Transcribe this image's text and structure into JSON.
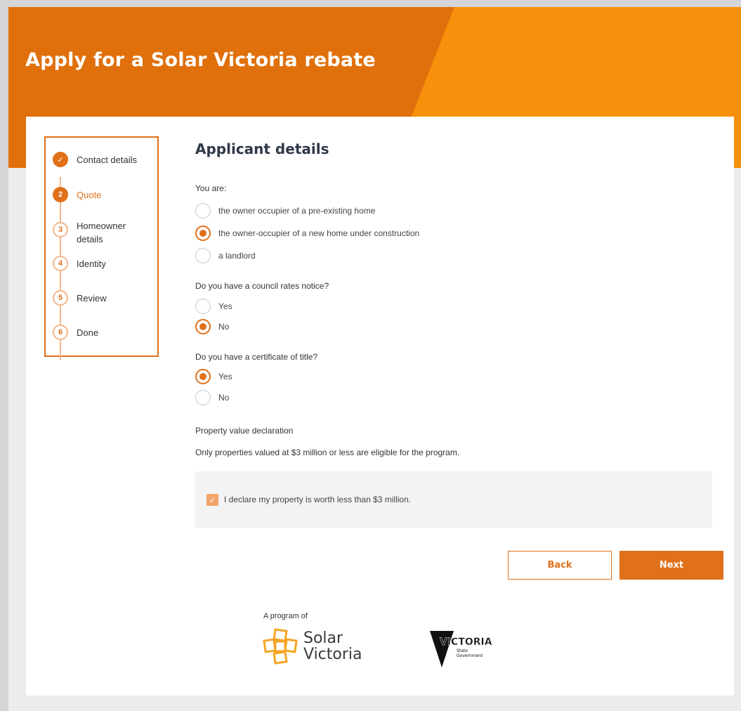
{
  "banner": {
    "title": "Apply for a Solar Victoria rebate"
  },
  "stepper": {
    "steps": [
      {
        "number": "✓",
        "label": "Contact details",
        "state": "done"
      },
      {
        "number": "2",
        "label": "Quote",
        "state": "current"
      },
      {
        "number": "3",
        "label": "Homeowner details",
        "state": "pending"
      },
      {
        "number": "4",
        "label": "Identity",
        "state": "pending"
      },
      {
        "number": "5",
        "label": "Review",
        "state": "pending"
      },
      {
        "number": "6",
        "label": "Done",
        "state": "pending"
      }
    ]
  },
  "form": {
    "heading": "Applicant details",
    "q1": {
      "label": "You are:",
      "options": [
        {
          "label": "the owner occupier of a pre-existing home",
          "selected": false
        },
        {
          "label": "the owner-occupier of a new home under construction",
          "selected": true
        },
        {
          "label": "a landlord",
          "selected": false
        }
      ]
    },
    "q2": {
      "label": "Do you have a council rates notice?",
      "options": [
        {
          "label": "Yes",
          "selected": false
        },
        {
          "label": "No",
          "selected": true
        }
      ]
    },
    "q3": {
      "label": "Do you have a certificate of title?",
      "options": [
        {
          "label": "Yes",
          "selected": true
        },
        {
          "label": "No",
          "selected": false
        }
      ]
    },
    "property": {
      "label": "Property value declaration",
      "note": "Only properties valued at $3 million or less are eligible for the program.",
      "declaration": "I declare my property is worth less than $3 million.",
      "checked": true
    },
    "back_label": "Back",
    "next_label": "Next"
  },
  "footer": {
    "program_of": "A program of",
    "solar_victoria_line1": "Solar",
    "solar_victoria_line2": "Victoria",
    "victoria_logo_text": "VICTORIA",
    "victoria_logo_sub1": "State",
    "victoria_logo_sub2": "Government"
  },
  "colors": {
    "accent": "#e07019",
    "banner_light": "#f7900a",
    "banner_dark": "#e0700c"
  }
}
